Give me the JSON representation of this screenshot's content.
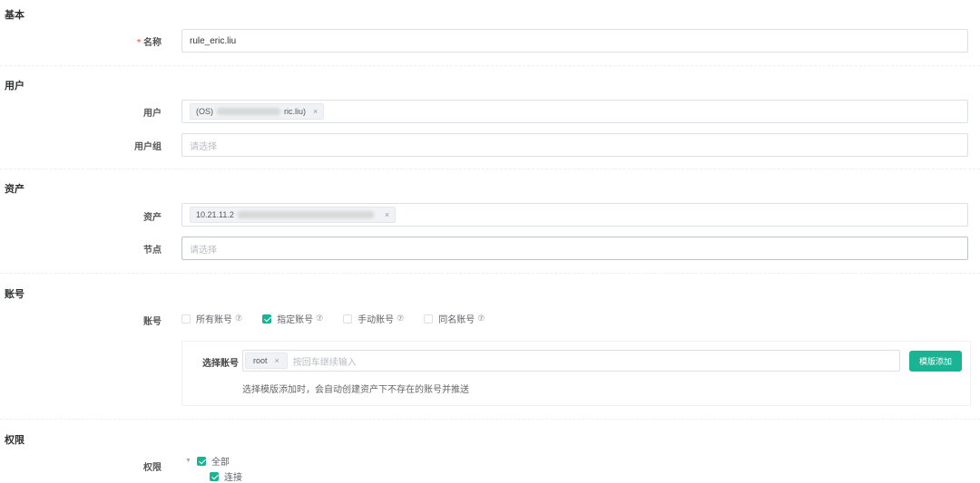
{
  "sections": {
    "basic": "基本",
    "user": "用户",
    "asset": "资产",
    "account": "账号",
    "perm": "权限"
  },
  "name": {
    "label": "名称",
    "value": "rule_eric.liu"
  },
  "users": {
    "label": "用户",
    "tag_prefix": "(OS)",
    "tag_suffix": "ric.liu)"
  },
  "user_groups": {
    "label": "用户组",
    "placeholder": "请选择"
  },
  "assets": {
    "label": "资产",
    "tag_prefix": "10.21.11.2"
  },
  "nodes": {
    "label": "节点",
    "placeholder": "请选择"
  },
  "accounts": {
    "label": "账号",
    "options": [
      {
        "label": "所有账号",
        "checked": false
      },
      {
        "label": "指定账号",
        "checked": true
      },
      {
        "label": "手动账号",
        "checked": false
      },
      {
        "label": "同名账号",
        "checked": false
      }
    ],
    "select_label": "选择账号",
    "tag": "root",
    "placeholder": "按回车继续输入",
    "template_button": "模版添加",
    "hint": "选择模版添加时，会自动创建资产下不存在的账号并推送"
  },
  "permissions": {
    "label": "权限",
    "all": "全部",
    "connect": "连接"
  },
  "accent": "#1ab394"
}
